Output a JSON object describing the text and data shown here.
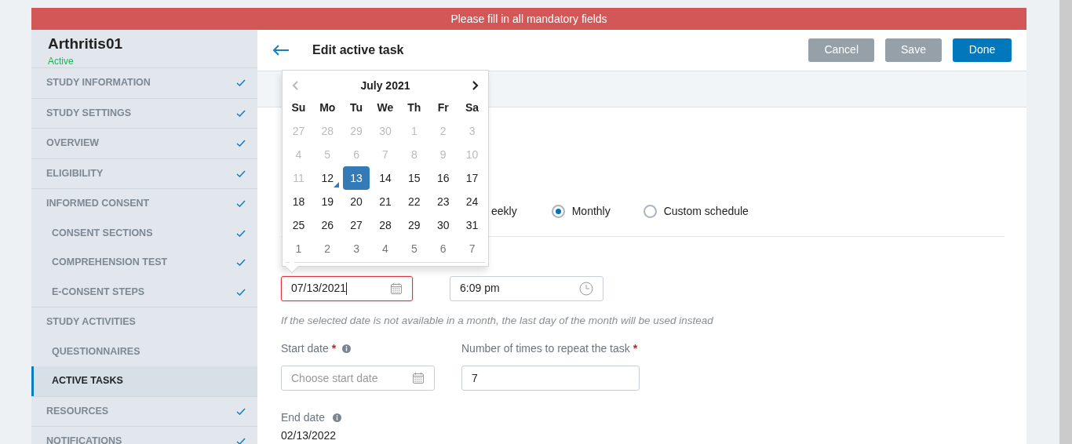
{
  "banner": {
    "text": "Please fill in all mandatory fields"
  },
  "study": {
    "name": "Arthritis01",
    "status": "Active"
  },
  "sidebar": {
    "items": [
      {
        "label": "STUDY INFORMATION",
        "checked": true,
        "selected": false
      },
      {
        "label": "STUDY SETTINGS",
        "checked": true,
        "selected": false
      },
      {
        "label": "OVERVIEW",
        "checked": true,
        "selected": false
      },
      {
        "label": "ELIGIBILITY",
        "checked": true,
        "selected": false
      },
      {
        "label": "INFORMED CONSENT",
        "checked": true,
        "selected": false,
        "children": [
          {
            "label": "CONSENT SECTIONS",
            "checked": true,
            "selected": false
          },
          {
            "label": "COMPREHENSION TEST",
            "checked": true,
            "selected": false
          },
          {
            "label": "E-CONSENT STEPS",
            "checked": true,
            "selected": false
          }
        ]
      },
      {
        "label": "STUDY ACTIVITIES",
        "checked": false,
        "selected": false,
        "children": [
          {
            "label": "QUESTIONNAIRES",
            "checked": false,
            "selected": false
          },
          {
            "label": "ACTIVE TASKS",
            "checked": false,
            "selected": true
          }
        ]
      },
      {
        "label": "RESOURCES",
        "checked": true,
        "selected": false
      },
      {
        "label": "NOTIFICATIONS",
        "checked": true,
        "selected": false
      }
    ]
  },
  "header": {
    "title": "Edit active task",
    "buttons": [
      {
        "label": "Cancel",
        "kind": "secondary"
      },
      {
        "label": "Save",
        "kind": "secondary"
      },
      {
        "label": "Done",
        "kind": "primary"
      }
    ]
  },
  "schedule": {
    "partial_label": "eekly",
    "options": [
      {
        "label": "Monthly",
        "selected": true
      },
      {
        "label": "Custom schedule",
        "selected": false
      }
    ]
  },
  "date_field": {
    "value": "07/13/2021",
    "invalid": true
  },
  "time_field": {
    "value": "6:09 pm"
  },
  "hint": "If the selected date is not available in a month, the last day of the month will be used instead",
  "start_date": {
    "label": "Start date",
    "required_mark": "*",
    "placeholder": "Choose start date"
  },
  "repeat": {
    "label": "Number of times to repeat the task",
    "required_mark": "*",
    "value": "7"
  },
  "end_date": {
    "label": "End date",
    "value": "02/13/2022"
  },
  "calendar": {
    "month": "July 2021",
    "prev_disabled": true,
    "weekdays": [
      "Su",
      "Mo",
      "Tu",
      "We",
      "Th",
      "Fr",
      "Sa"
    ],
    "weeks": [
      [
        {
          "day": "27",
          "kind": "disabled",
          "selected": false,
          "today": false
        },
        {
          "day": "28",
          "kind": "disabled",
          "selected": false,
          "today": false
        },
        {
          "day": "29",
          "kind": "disabled",
          "selected": false,
          "today": false
        },
        {
          "day": "30",
          "kind": "disabled",
          "selected": false,
          "today": false
        },
        {
          "day": "1",
          "kind": "disabled",
          "selected": false,
          "today": false
        },
        {
          "day": "2",
          "kind": "disabled",
          "selected": false,
          "today": false
        },
        {
          "day": "3",
          "kind": "disabled",
          "selected": false,
          "today": false
        }
      ],
      [
        {
          "day": "4",
          "kind": "disabled",
          "selected": false,
          "today": false
        },
        {
          "day": "5",
          "kind": "disabled",
          "selected": false,
          "today": false
        },
        {
          "day": "6",
          "kind": "disabled",
          "selected": false,
          "today": false
        },
        {
          "day": "7",
          "kind": "disabled",
          "selected": false,
          "today": false
        },
        {
          "day": "8",
          "kind": "disabled",
          "selected": false,
          "today": false
        },
        {
          "day": "9",
          "kind": "disabled",
          "selected": false,
          "today": false
        },
        {
          "day": "10",
          "kind": "disabled",
          "selected": false,
          "today": false
        }
      ],
      [
        {
          "day": "11",
          "kind": "disabled",
          "selected": false,
          "today": false
        },
        {
          "day": "12",
          "kind": "current",
          "selected": false,
          "today": true
        },
        {
          "day": "13",
          "kind": "current",
          "selected": true,
          "today": false
        },
        {
          "day": "14",
          "kind": "current",
          "selected": false,
          "today": false
        },
        {
          "day": "15",
          "kind": "current",
          "selected": false,
          "today": false
        },
        {
          "day": "16",
          "kind": "current",
          "selected": false,
          "today": false
        },
        {
          "day": "17",
          "kind": "current",
          "selected": false,
          "today": false
        }
      ],
      [
        {
          "day": "18",
          "kind": "current",
          "selected": false,
          "today": false
        },
        {
          "day": "19",
          "kind": "current",
          "selected": false,
          "today": false
        },
        {
          "day": "20",
          "kind": "current",
          "selected": false,
          "today": false
        },
        {
          "day": "21",
          "kind": "current",
          "selected": false,
          "today": false
        },
        {
          "day": "22",
          "kind": "current",
          "selected": false,
          "today": false
        },
        {
          "day": "23",
          "kind": "current",
          "selected": false,
          "today": false
        },
        {
          "day": "24",
          "kind": "current",
          "selected": false,
          "today": false
        }
      ],
      [
        {
          "day": "25",
          "kind": "current",
          "selected": false,
          "today": false
        },
        {
          "day": "26",
          "kind": "current",
          "selected": false,
          "today": false
        },
        {
          "day": "27",
          "kind": "current",
          "selected": false,
          "today": false
        },
        {
          "day": "28",
          "kind": "current",
          "selected": false,
          "today": false
        },
        {
          "day": "29",
          "kind": "current",
          "selected": false,
          "today": false
        },
        {
          "day": "30",
          "kind": "current",
          "selected": false,
          "today": false
        },
        {
          "day": "31",
          "kind": "current",
          "selected": false,
          "today": false
        }
      ],
      [
        {
          "day": "1",
          "kind": "next_month",
          "selected": false,
          "today": false
        },
        {
          "day": "2",
          "kind": "next_month",
          "selected": false,
          "today": false
        },
        {
          "day": "3",
          "kind": "next_month",
          "selected": false,
          "today": false
        },
        {
          "day": "4",
          "kind": "next_month",
          "selected": false,
          "today": false
        },
        {
          "day": "5",
          "kind": "next_month",
          "selected": false,
          "today": false
        },
        {
          "day": "6",
          "kind": "next_month",
          "selected": false,
          "today": false
        },
        {
          "day": "7",
          "kind": "next_month",
          "selected": false,
          "today": false
        }
      ]
    ]
  }
}
